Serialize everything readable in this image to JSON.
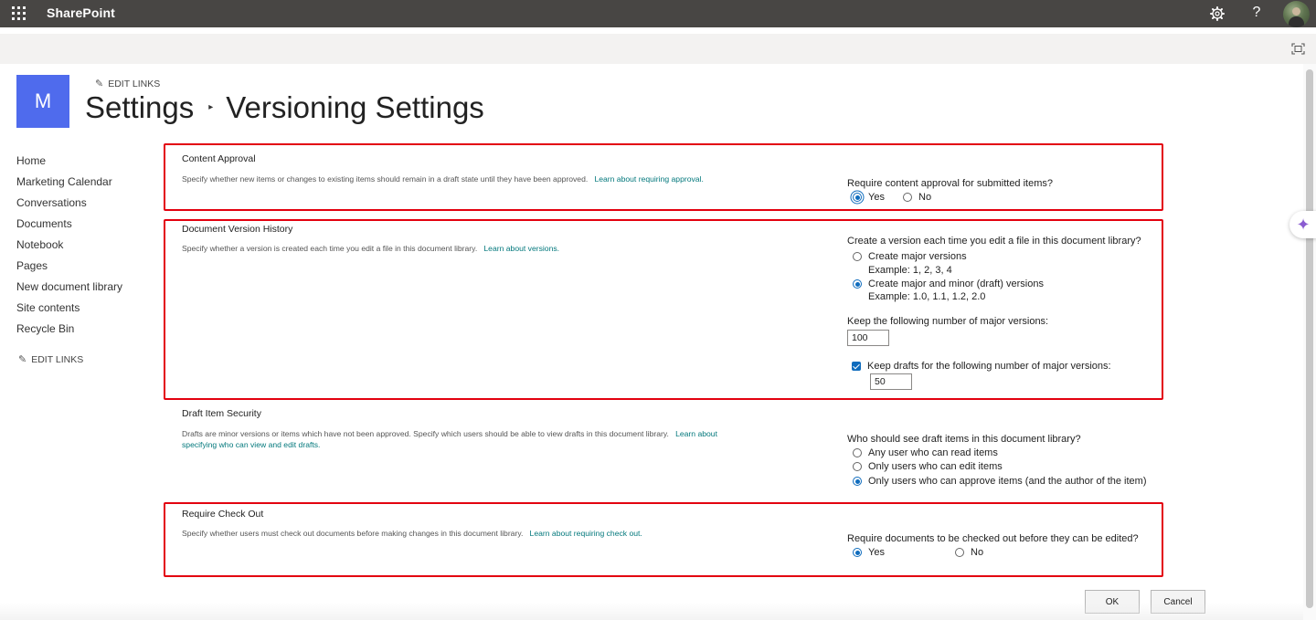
{
  "suitebar": {
    "app_name": "SharePoint",
    "settings_icon": "gear-icon",
    "help_label": "?",
    "avatar": "user-avatar"
  },
  "header": {
    "site_logo_letter": "M",
    "edit_links": "EDIT LINKS",
    "breadcrumb_parent": "Settings",
    "breadcrumb_separator": "▸",
    "page_title": "Versioning Settings"
  },
  "leftnav": {
    "items": [
      "Home",
      "Marketing Calendar",
      "Conversations",
      "Documents",
      "Notebook",
      "Pages",
      "New document library",
      "Site contents",
      "Recycle Bin"
    ],
    "edit_links": "EDIT LINKS"
  },
  "sections": {
    "content_approval": {
      "title": "Content Approval",
      "description": "Specify whether new items or changes to existing items should remain in a draft state until they have been approved.",
      "link": "Learn about requiring approval.",
      "question": "Require content approval for submitted items?",
      "yes": "Yes",
      "no": "No",
      "selected": "Yes"
    },
    "version_history": {
      "title": "Document Version History",
      "description": "Specify whether a version is created each time you edit a file in this document library.",
      "link": "Learn about versions.",
      "question": "Create a version each time you edit a file in this document library?",
      "option_major": "Create major versions",
      "example_major": "Example: 1, 2, 3, 4",
      "option_minor": "Create major and minor (draft) versions",
      "example_minor": "Example: 1.0, 1.1, 1.2, 2.0",
      "selected": "Create major and minor (draft) versions",
      "keep_major_label": "Keep the following number of major versions:",
      "keep_major_value": "100",
      "keep_drafts_label": "Keep drafts for the following number of major versions:",
      "keep_drafts_checked": true,
      "keep_drafts_value": "50"
    },
    "draft_security": {
      "title": "Draft Item Security",
      "description": "Drafts are minor versions or items which have not been approved. Specify which users should be able to view drafts in this document library.",
      "link_part1": "Learn about",
      "link_part2": "specifying who can view and edit drafts.",
      "question": "Who should see draft items in this document library?",
      "option_read": "Any user who can read items",
      "option_edit": "Only users who can edit items",
      "option_approve": "Only users who can approve items (and the author of the item)",
      "selected": "Only users who can approve items (and the author of the item)"
    },
    "check_out": {
      "title": "Require Check Out",
      "description": "Specify whether users must check out documents before making changes in this document library.",
      "link": "Learn about requiring check out.",
      "question": "Require documents to be checked out before they can be edited?",
      "yes": "Yes",
      "no": "No",
      "selected": "Yes"
    }
  },
  "buttons": {
    "ok": "OK",
    "cancel": "Cancel"
  },
  "colors": {
    "suitebar": "#484644",
    "logo": "#4f6bed",
    "link": "#03787c",
    "highlight_box": "#e3000f",
    "radio_selected": "#0f6cbd"
  }
}
